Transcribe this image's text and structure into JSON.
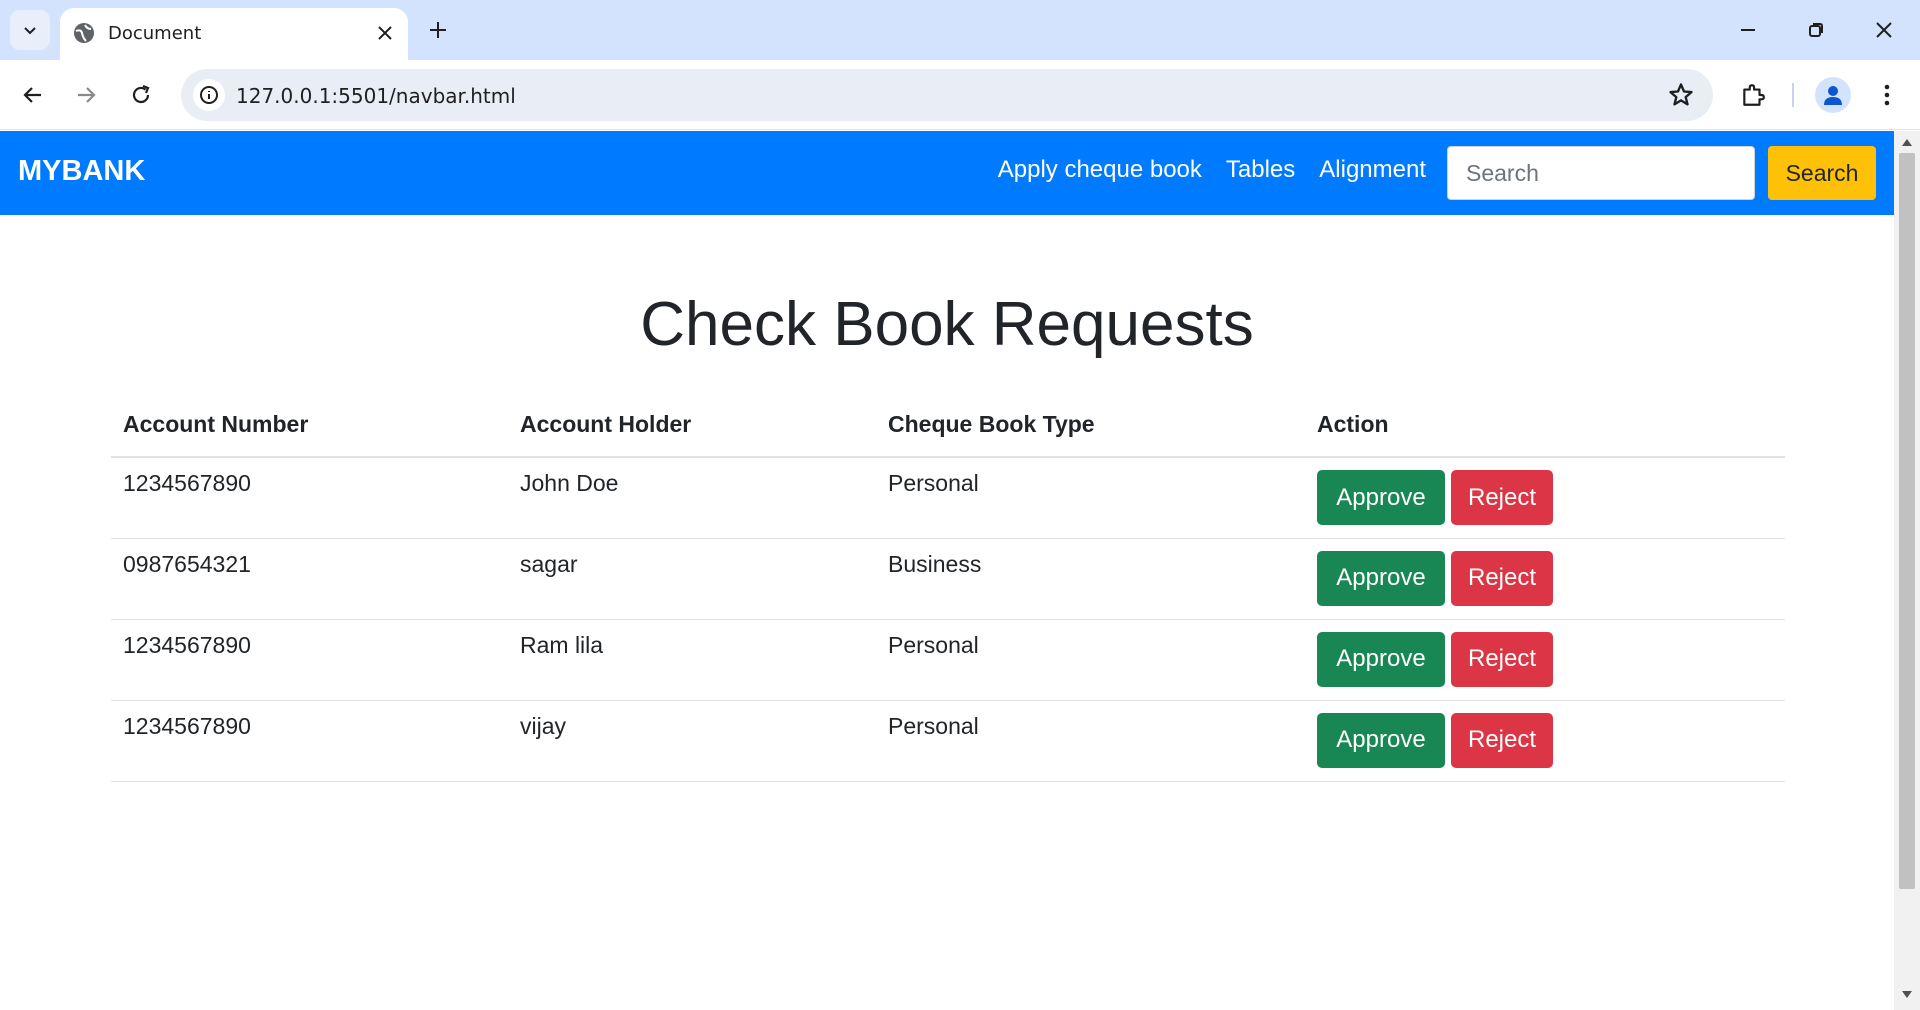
{
  "browser": {
    "tab_title": "Document",
    "url": "127.0.0.1:5501/navbar.html"
  },
  "navbar": {
    "brand": "MYBANK",
    "links": [
      "Apply cheque book",
      "Tables",
      "Alignment"
    ],
    "search_placeholder": "Search",
    "search_value": "",
    "search_button": "Search"
  },
  "page": {
    "heading": "Check Book Requests"
  },
  "table": {
    "headers": [
      "Account Number",
      "Account Holder",
      "Cheque Book Type",
      "Action"
    ],
    "rows": [
      {
        "account_number": "1234567890",
        "holder": "John Doe",
        "type": "Personal"
      },
      {
        "account_number": "0987654321",
        "holder": "sagar",
        "type": "Business"
      },
      {
        "account_number": "1234567890",
        "holder": "Ram lila",
        "type": "Personal"
      },
      {
        "account_number": "1234567890",
        "holder": "vijay",
        "type": "Personal"
      }
    ],
    "approve_label": "Approve",
    "reject_label": "Reject"
  },
  "colors": {
    "navbar_bg": "#007bff",
    "search_button_bg": "#ffc107",
    "approve_bg": "#198754",
    "reject_bg": "#dc3545"
  }
}
